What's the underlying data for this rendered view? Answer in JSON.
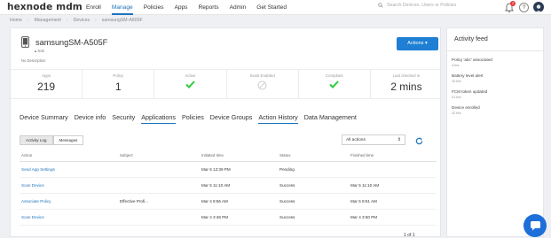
{
  "brand": {
    "logo": "hexnode mdm"
  },
  "nav": {
    "items": [
      "Enroll",
      "Manage",
      "Policies",
      "Apps",
      "Reports",
      "Admin",
      "Get Started"
    ],
    "active": "Manage"
  },
  "search": {
    "placeholder": "Search Devices, Users or Policies"
  },
  "notifications": {
    "count": "2"
  },
  "help": {
    "label": "?"
  },
  "breadcrumb": [
    "Home",
    "Management",
    "Devices",
    "samsungSM-A505F"
  ],
  "device": {
    "name": "samsungSM-A505F",
    "user": "Sob",
    "description": "No Description",
    "actions_label": "Actions ▾"
  },
  "stats": [
    {
      "label": "Apps",
      "value": "219"
    },
    {
      "label": "Policy",
      "value": "1"
    },
    {
      "label": "Active",
      "value": "",
      "icon": "check-icon"
    },
    {
      "label": "Kiosk Enabled",
      "value": "",
      "icon": "disabled-icon"
    },
    {
      "label": "Compliant",
      "value": "",
      "icon": "check-icon"
    },
    {
      "label": "Last checked in",
      "value": "2 mins"
    }
  ],
  "tabs": [
    "Device Summary",
    "Device info",
    "Security",
    "Applications",
    "Policies",
    "Device Groups",
    "Action History",
    "Data Management"
  ],
  "sub_tabs": [
    "Activity Log",
    "Messages"
  ],
  "filter": {
    "value": "All actions"
  },
  "table": {
    "columns": [
      "Action",
      "Subject",
      "Initiated time",
      "Status",
      "Finished time"
    ],
    "rows": [
      [
        "Send App Settings",
        "",
        "Mar 6 12:39 PM",
        "Pending",
        ""
      ],
      [
        "Scan Device",
        "",
        "Mar 5 11:10 AM",
        "Success",
        "Mar 5 11:10 AM"
      ],
      [
        "Associate Policy",
        "Effective Profi...",
        "Mar 4 8:56 AM",
        "Success",
        "Mar 5 9:51 AM"
      ],
      [
        "Scan Device",
        "",
        "Mar 4 3:48 PM",
        "Success",
        "Mar 4 3:50 PM"
      ]
    ]
  },
  "pager": {
    "text": "1 of 1"
  },
  "feed": {
    "title": "Activity feed",
    "items": [
      {
        "text": "Policy 'abc' associated",
        "time": "4 hrs"
      },
      {
        "text": "Battery level alert",
        "time": "10 hrs"
      },
      {
        "text": "FCM token updated",
        "time": "21 hrs"
      },
      {
        "text": "Device enrolled",
        "time": "22 hrs"
      }
    ]
  },
  "colors": {
    "accent": "#1e73be",
    "button": "#1e7fd4",
    "success": "#2ecc40",
    "badge": "#e53935"
  }
}
